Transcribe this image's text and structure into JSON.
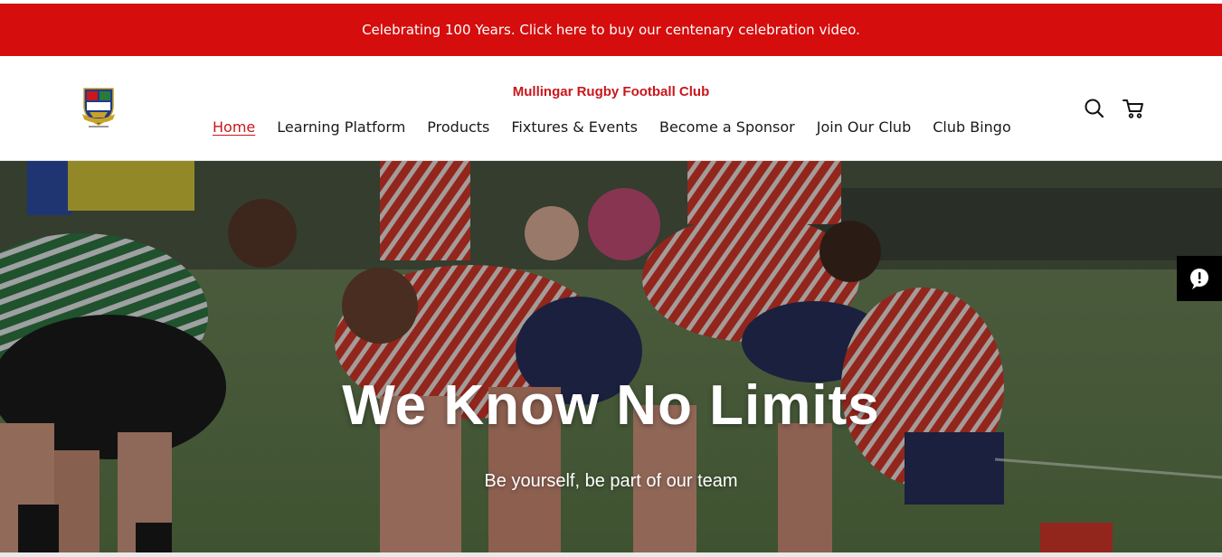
{
  "announcement": {
    "text": "Celebrating 100 Years. Click here to buy our centenary celebration video."
  },
  "header": {
    "site_title": "Mullingar Rugby Football Club",
    "logo_icon": "club-crest-logo",
    "nav": [
      {
        "label": "Home",
        "active": true
      },
      {
        "label": "Learning Platform",
        "active": false
      },
      {
        "label": "Products",
        "active": false
      },
      {
        "label": "Fixtures & Events",
        "active": false
      },
      {
        "label": "Become a Sponsor",
        "active": false
      },
      {
        "label": "Join Our Club",
        "active": false
      },
      {
        "label": "Club Bingo",
        "active": false
      }
    ],
    "icons": {
      "search": "search-icon",
      "cart": "cart-icon"
    }
  },
  "hero": {
    "title": "We Know No Limits",
    "subtitle": "Be yourself, be part of our team"
  },
  "feedback": {
    "icon": "chat-alert-icon"
  },
  "colors": {
    "brand_red": "#d60d0d",
    "title_red": "#c8171d",
    "nav_text": "#1a1a1a",
    "hero_overlay": "#000000"
  }
}
